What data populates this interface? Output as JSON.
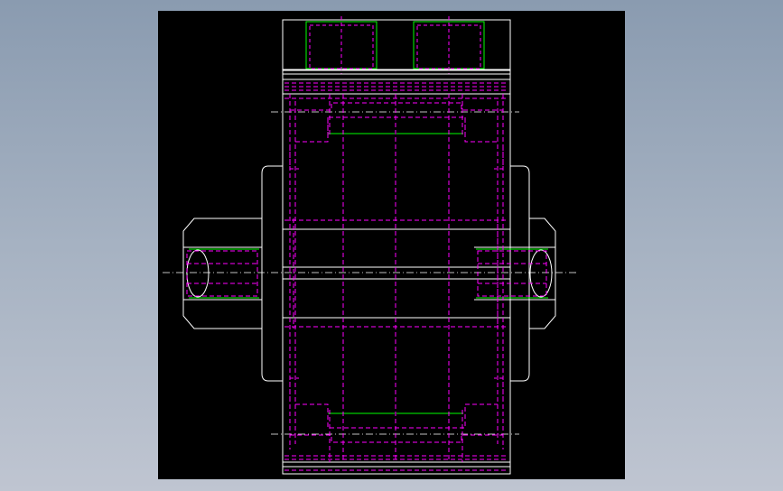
{
  "viewer": {
    "background_top": "#8a9bb0",
    "background_bottom": "#bfc5d1",
    "canvas_color": "#000000"
  },
  "drawing": {
    "colors": {
      "outline": "#ffffff",
      "hidden": "#ff00ff",
      "thread": "#00ff00",
      "center": "#ffffff"
    }
  }
}
